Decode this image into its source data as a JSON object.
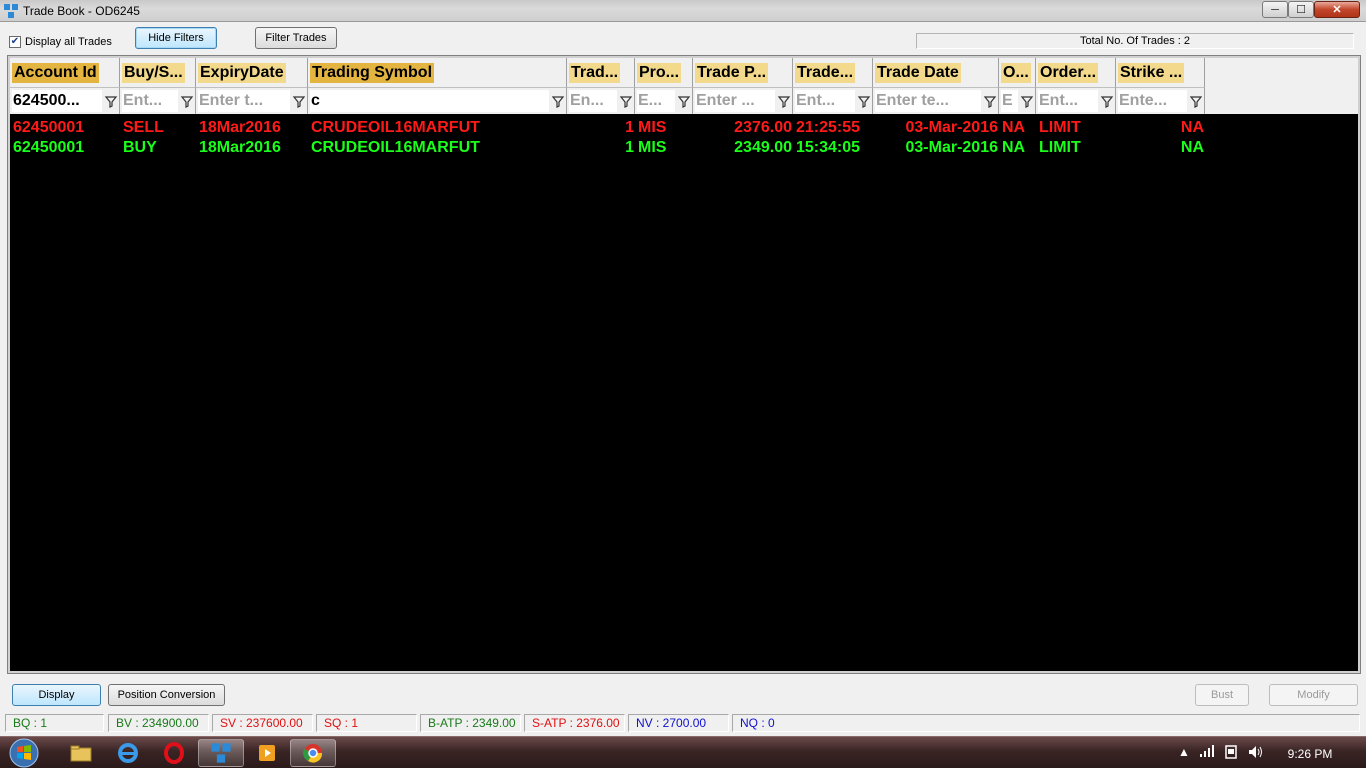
{
  "window": {
    "title": "Trade Book - OD6245",
    "min_glyph": "─",
    "max_glyph": "☐",
    "close_glyph": "✕"
  },
  "toolbar": {
    "checkbox_checked": true,
    "checkbox_label": "Display all Trades",
    "hide_filters": "Hide Filters",
    "filter_trades": "Filter Trades",
    "total_trades": "Total No. Of Trades : 2"
  },
  "columns": [
    {
      "key": "account_id",
      "label": "Account Id",
      "filter": "624500...",
      "filter_has_value": true,
      "sorted": true
    },
    {
      "key": "buy_sell",
      "label": "Buy/S...",
      "filter": "Ent...",
      "filter_has_value": false,
      "sorted": false
    },
    {
      "key": "expiry",
      "label": "ExpiryDate",
      "filter": "Enter t...",
      "filter_has_value": false,
      "sorted": false
    },
    {
      "key": "symbol",
      "label": "Trading Symbol",
      "filter": "c",
      "filter_has_value": true,
      "sorted": true
    },
    {
      "key": "trade_qty",
      "label": "Trad...",
      "filter": "En...",
      "filter_has_value": false,
      "sorted": false
    },
    {
      "key": "product",
      "label": "Pro...",
      "filter": "E...",
      "filter_has_value": false,
      "sorted": false
    },
    {
      "key": "trade_price",
      "label": "Trade P...",
      "filter": "Enter ...",
      "filter_has_value": false,
      "sorted": false
    },
    {
      "key": "trade_time",
      "label": "Trade...",
      "filter": "Ent...",
      "filter_has_value": false,
      "sorted": false
    },
    {
      "key": "trade_date",
      "label": "Trade Date",
      "filter": "Enter te...",
      "filter_has_value": false,
      "sorted": false
    },
    {
      "key": "o",
      "label": "O...",
      "filter": "E",
      "filter_has_value": false,
      "sorted": false
    },
    {
      "key": "order_type",
      "label": "Order...",
      "filter": "Ent...",
      "filter_has_value": false,
      "sorted": false
    },
    {
      "key": "strike",
      "label": "Strike ...",
      "filter": "Ente...",
      "filter_has_value": false,
      "sorted": false
    }
  ],
  "rows": [
    {
      "side_class": "sell",
      "account_id": "62450001",
      "buy_sell": "SELL",
      "expiry": "18Mar2016",
      "symbol": "CRUDEOIL16MARFUT",
      "trade_qty": "1",
      "product": "MIS",
      "trade_price": "2376.00",
      "trade_time": "21:25:55",
      "trade_date": "03-Mar-2016",
      "o": "NA",
      "order_type": "LIMIT",
      "strike": "NA"
    },
    {
      "side_class": "buy",
      "account_id": "62450001",
      "buy_sell": "BUY",
      "expiry": "18Mar2016",
      "symbol": "CRUDEOIL16MARFUT",
      "trade_qty": "1",
      "product": "MIS",
      "trade_price": "2349.00",
      "trade_time": "15:34:05",
      "trade_date": "03-Mar-2016",
      "o": "NA",
      "order_type": "LIMIT",
      "strike": "NA"
    }
  ],
  "bottom_buttons": {
    "display": "Display",
    "position_conversion": "Position Conversion",
    "bust": "Bust",
    "modify": "Modify"
  },
  "status": [
    {
      "label": "BQ : 1",
      "color": "#1a7a1a"
    },
    {
      "label": "BV : 234900.00",
      "color": "#1a7a1a"
    },
    {
      "label": "SV : 237600.00",
      "color": "#e01010"
    },
    {
      "label": "SQ : 1",
      "color": "#e01010"
    },
    {
      "label": "B-ATP : 2349.00",
      "color": "#1a7a1a"
    },
    {
      "label": "S-ATP : 2376.00",
      "color": "#e01010"
    },
    {
      "label": "NV : 2700.00",
      "color": "#1010d0"
    },
    {
      "label": "NQ : 0",
      "color": "#1010d0"
    }
  ],
  "taskbar": {
    "items": [
      "start-button",
      "file-explorer-icon",
      "internet-explorer-icon",
      "opera-icon",
      "trade-app-icon",
      "media-player-icon",
      "chrome-icon"
    ],
    "active_item": "trade-app-icon",
    "clock": "9:26 PM"
  }
}
